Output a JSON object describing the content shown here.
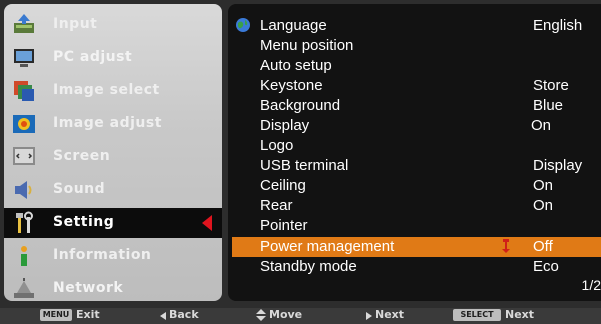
{
  "menu": {
    "items": [
      {
        "label": "Input",
        "icon": "input-icon",
        "active": false
      },
      {
        "label": "PC adjust",
        "icon": "pc-adjust-icon",
        "active": false
      },
      {
        "label": "Image select",
        "icon": "image-select-icon",
        "active": false
      },
      {
        "label": "Image adjust",
        "icon": "image-adjust-icon",
        "active": false
      },
      {
        "label": "Screen",
        "icon": "screen-icon",
        "active": false
      },
      {
        "label": "Sound",
        "icon": "sound-icon",
        "active": false
      },
      {
        "label": "Setting",
        "icon": "setting-icon",
        "active": true
      },
      {
        "label": "Information",
        "icon": "information-icon",
        "active": false
      },
      {
        "label": "Network",
        "icon": "network-icon",
        "active": false
      }
    ]
  },
  "settings": {
    "rows": [
      {
        "label": "Language",
        "value": "English"
      },
      {
        "label": "Menu position",
        "value": ""
      },
      {
        "label": "Auto setup",
        "value": ""
      },
      {
        "label": "Keystone",
        "value": "Store"
      },
      {
        "label": "Background",
        "value": "Blue"
      },
      {
        "label": "Display",
        "value": "On"
      },
      {
        "label": "Logo",
        "value": ""
      },
      {
        "label": "USB terminal",
        "value": "Display"
      },
      {
        "label": "Ceiling",
        "value": "On"
      },
      {
        "label": "Rear",
        "value": "On"
      },
      {
        "label": "Pointer",
        "value": ""
      },
      {
        "label": "Power management",
        "value": "Off"
      },
      {
        "label": "Standby mode",
        "value": "Eco"
      }
    ],
    "selected_index": 11,
    "page_indicator": "1/2"
  },
  "footer": {
    "exit_key": "MENU",
    "exit": "Exit",
    "back": "Back",
    "move": "Move",
    "next": "Next",
    "select_key": "SELECT",
    "select_next": "Next"
  },
  "colors": {
    "highlight": "#e07a16",
    "active_arrow": "#e0141e",
    "panel_bg": "#121212",
    "menu_bg": "#c9c9c9"
  }
}
